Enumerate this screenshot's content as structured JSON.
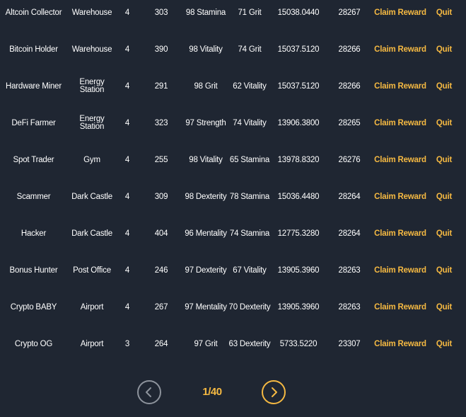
{
  "colors": {
    "background": "#1f2632",
    "text": "#ffffff",
    "accent": "#f5b942",
    "muted": "#8d939c"
  },
  "rows": [
    {
      "name": "Altcoin Collector",
      "location": "Warehouse",
      "level": "4",
      "power": "303",
      "stat1": "98 Stamina",
      "stat2": "71 Grit",
      "value": "15038.0440",
      "id": "28267",
      "claim": "Claim Reward",
      "quit": "Quit"
    },
    {
      "name": "Bitcoin Holder",
      "location": "Warehouse",
      "level": "4",
      "power": "390",
      "stat1": "98 Vitality",
      "stat2": "74 Grit",
      "value": "15037.5120",
      "id": "28266",
      "claim": "Claim Reward",
      "quit": "Quit"
    },
    {
      "name": "Hardware Miner",
      "location": "Energy Station",
      "level": "4",
      "power": "291",
      "stat1": "98 Grit",
      "stat2": "62 Vitality",
      "value": "15037.5120",
      "id": "28266",
      "claim": "Claim Reward",
      "quit": "Quit"
    },
    {
      "name": "DeFi Farmer",
      "location": "Energy Station",
      "level": "4",
      "power": "323",
      "stat1": "97 Strength",
      "stat2": "74 Vitality",
      "value": "13906.3800",
      "id": "28265",
      "claim": "Claim Reward",
      "quit": "Quit"
    },
    {
      "name": "Spot Trader",
      "location": "Gym",
      "level": "4",
      "power": "255",
      "stat1": "98 Vitality",
      "stat2": "65 Stamina",
      "value": "13978.8320",
      "id": "26276",
      "claim": "Claim Reward",
      "quit": "Quit"
    },
    {
      "name": "Scammer",
      "location": "Dark Castle",
      "level": "4",
      "power": "309",
      "stat1": "98 Dexterity",
      "stat2": "78 Stamina",
      "value": "15036.4480",
      "id": "28264",
      "claim": "Claim Reward",
      "quit": "Quit"
    },
    {
      "name": "Hacker",
      "location": "Dark Castle",
      "level": "4",
      "power": "404",
      "stat1": "96 Mentality",
      "stat2": "74 Stamina",
      "value": "12775.3280",
      "id": "28264",
      "claim": "Claim Reward",
      "quit": "Quit"
    },
    {
      "name": "Bonus Hunter",
      "location": "Post Office",
      "level": "4",
      "power": "246",
      "stat1": "97 Dexterity",
      "stat2": "67 Vitality",
      "value": "13905.3960",
      "id": "28263",
      "claim": "Claim Reward",
      "quit": "Quit"
    },
    {
      "name": "Crypto BABY",
      "location": "Airport",
      "level": "4",
      "power": "267",
      "stat1": "97 Mentality",
      "stat2": "70 Dexterity",
      "value": "13905.3960",
      "id": "28263",
      "claim": "Claim Reward",
      "quit": "Quit"
    },
    {
      "name": "Crypto OG",
      "location": "Airport",
      "level": "3",
      "power": "264",
      "stat1": "97 Grit",
      "stat2": "63 Dexterity",
      "value": "5733.5220",
      "id": "23307",
      "claim": "Claim Reward",
      "quit": "Quit"
    }
  ],
  "pagination": {
    "label": "1/40",
    "prev_icon": "chevron-left-icon",
    "next_icon": "chevron-right-icon"
  }
}
